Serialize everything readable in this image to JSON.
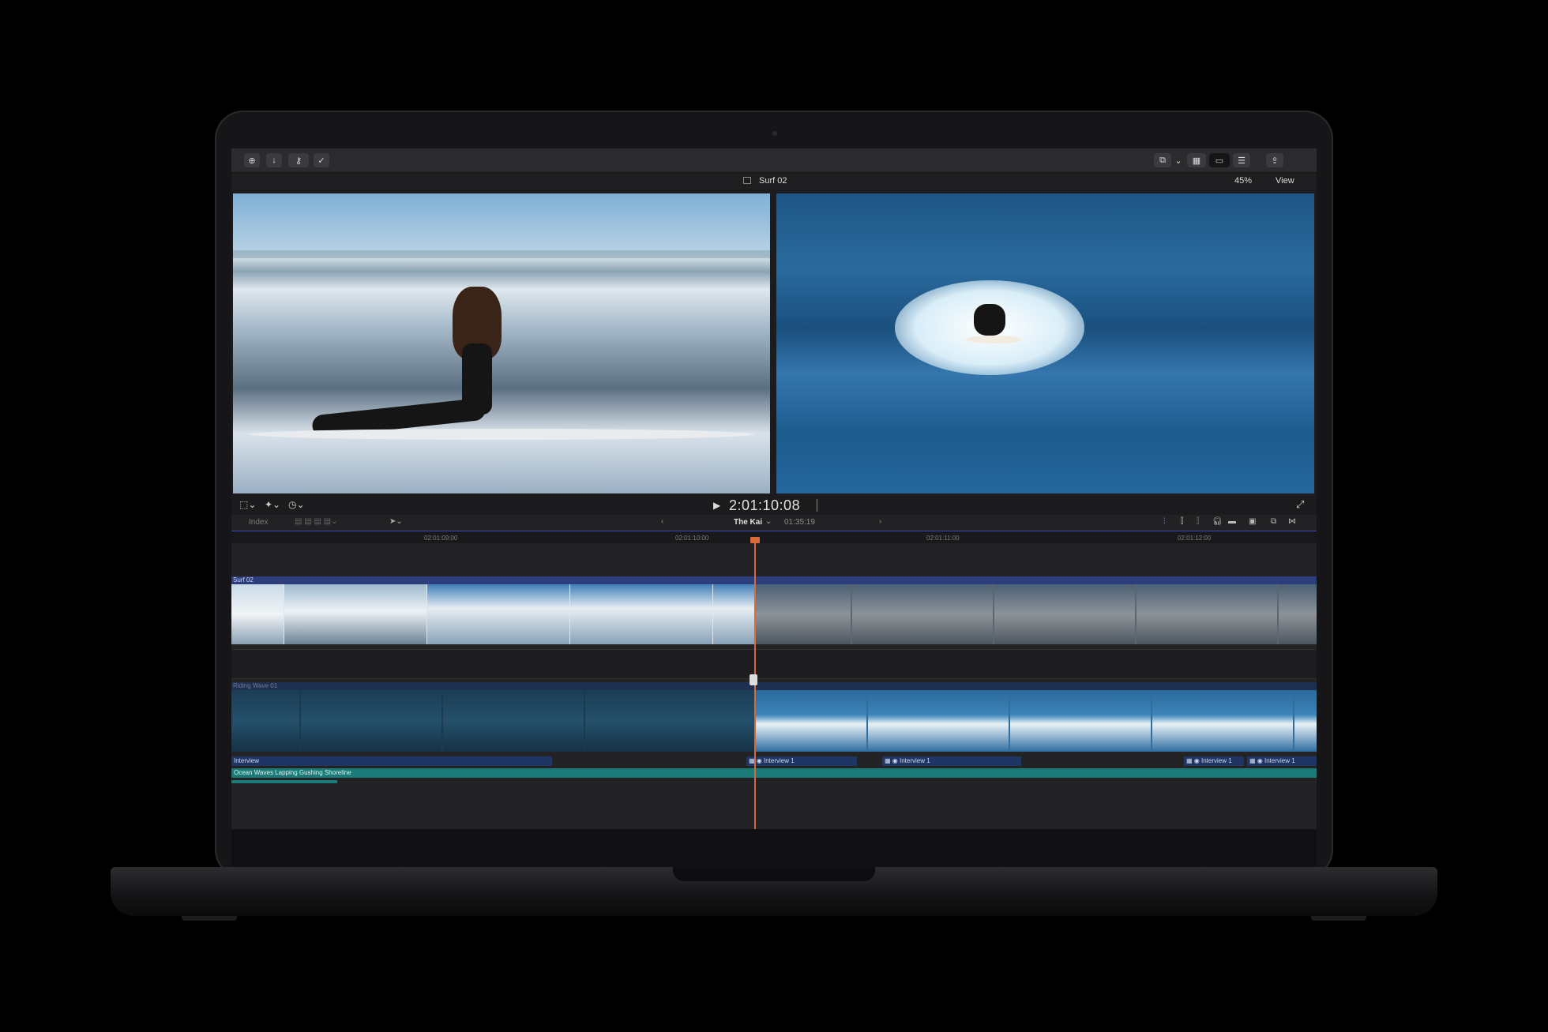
{
  "toolbar": {
    "left_icons": [
      "import-icon",
      "download-icon",
      "keywords-icon",
      "checkmark-icon"
    ],
    "right_icons": [
      "effects-icon",
      "chevron-down-icon",
      "browser-grid-icon",
      "timeline-icon",
      "inspector-icon",
      "share-icon"
    ]
  },
  "viewer": {
    "clip_title": "Surf 02",
    "zoom": "45%",
    "view_label": "View"
  },
  "transport": {
    "timecode": "2:01:10:08"
  },
  "timeline": {
    "index_label": "Index",
    "project_name": "The Kai",
    "duration": "01:35:19",
    "ruler_ticks": [
      "02:01:09:00",
      "02:01:10:00",
      "02:01:11:00",
      "02:01:12:00"
    ],
    "tracks": {
      "top_label": "Surf 02",
      "bottom_label": "Riding Wave 01"
    },
    "audio": {
      "interview_main": "Interview",
      "interview_clips": [
        "Interview 1",
        "Interview 1",
        "Interview 1",
        "Interview 1"
      ],
      "ambience": "Ocean Waves Lapping Gushing Shoreline"
    }
  },
  "colors": {
    "playhead": "#d86a3a",
    "selection_blue": "#3a4cb0",
    "ambience_teal": "#1a7b78"
  }
}
